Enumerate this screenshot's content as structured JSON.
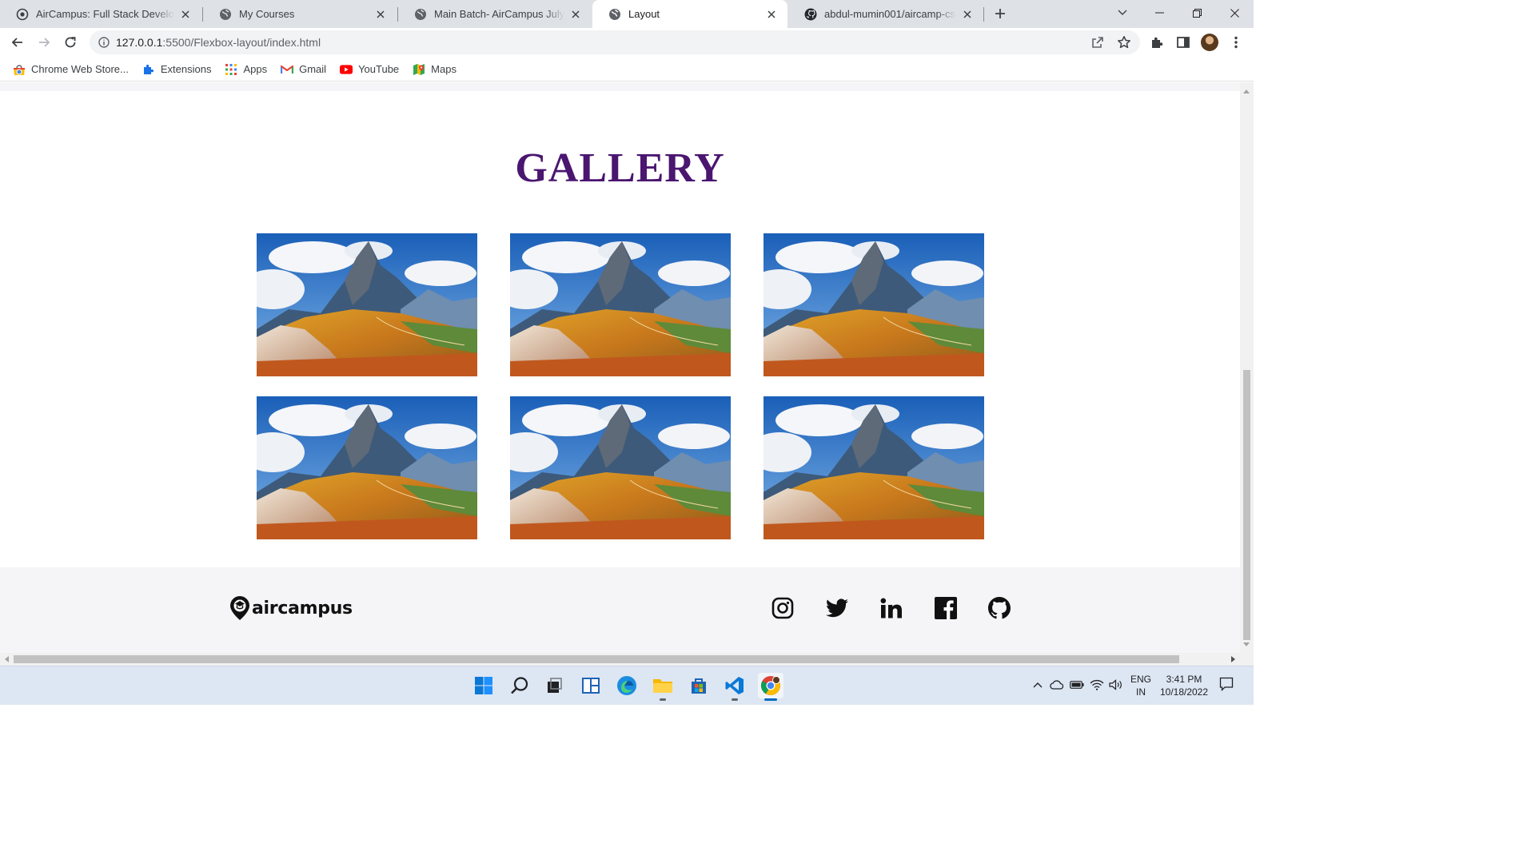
{
  "browser": {
    "tabs": [
      {
        "title": "AirCampus: Full Stack Developme",
        "icon": "aircampus-icon",
        "active": false
      },
      {
        "title": "My Courses",
        "icon": "globe-icon",
        "active": false
      },
      {
        "title": "Main Batch- AirCampus July-Aug",
        "icon": "globe-icon",
        "active": false
      },
      {
        "title": "Layout",
        "icon": "globe-icon",
        "active": true
      },
      {
        "title": "abdul-mumin001/aircamp-css-la",
        "icon": "github-icon",
        "active": false
      }
    ],
    "url_host": "127.0.0.1",
    "url_path": ":5500/Flexbox-layout/index.html",
    "bookmarks": [
      {
        "label": "Chrome Web Store...",
        "icon": "chrome-web-store-icon"
      },
      {
        "label": "Extensions",
        "icon": "puzzle-icon"
      },
      {
        "label": "Apps",
        "icon": "apps-grid-icon"
      },
      {
        "label": "Gmail",
        "icon": "gmail-icon"
      },
      {
        "label": "YouTube",
        "icon": "youtube-icon"
      },
      {
        "label": "Maps",
        "icon": "maps-icon"
      }
    ]
  },
  "page": {
    "gallery_title": "GALLERY",
    "gallery_image_count": 6,
    "footer": {
      "logo_text": "aircampus",
      "social_icons": [
        "instagram-icon",
        "twitter-icon",
        "linkedin-icon",
        "facebook-icon",
        "github-icon"
      ]
    },
    "colors": {
      "title": "#4a1670",
      "footer_bg": "#f5f5f7"
    }
  },
  "taskbar": {
    "apps": [
      "windows-start-icon",
      "search-icon",
      "task-view-icon",
      "widgets-icon",
      "edge-icon",
      "file-explorer-icon",
      "microsoft-store-icon",
      "vscode-icon",
      "chrome-icon"
    ],
    "language": "ENG",
    "region": "IN",
    "time": "3:41 PM",
    "date": "10/18/2022"
  }
}
